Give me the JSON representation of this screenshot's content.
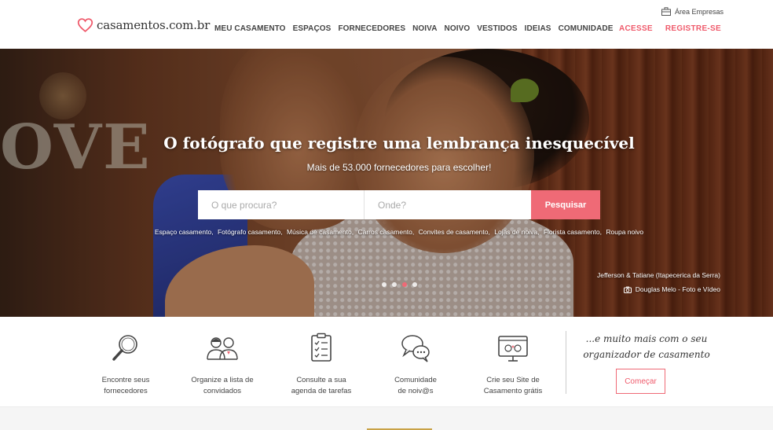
{
  "header": {
    "logo_text": "casamentos.com.br",
    "nav": [
      "Meu casamento",
      "Espaços",
      "Fornecedores",
      "Noiva",
      "Noivo",
      "Vestidos",
      "Ideias",
      "Comunidade"
    ],
    "area_empresas": "Área Empresas",
    "login": "ACESSE",
    "register": "REGISTRE-SE"
  },
  "hero": {
    "title": "O fotógrafo que registre uma lembrança inesquecível",
    "subtitle": "Mais de 53.000 fornecedores para escolher!",
    "background_text": "OVE",
    "search": {
      "what_placeholder": "O que procura?",
      "where_placeholder": "Onde?",
      "button": "Pesquisar"
    },
    "popular": [
      "Espaço casamento",
      "Fotógrafo casamento",
      "Música de casamento",
      "Carros casamento",
      "Convites de casamento",
      "Lojas de noiva",
      "Florista casamento",
      "Roupa noivo"
    ],
    "credit_couple": "Jefferson & Tatiane (Itapecerica da Serra)",
    "credit_photographer": "Douglas Melo - Foto e Vídeo",
    "slides": 4,
    "active_slide": 3
  },
  "features": {
    "items": [
      {
        "icon": "magnifier-icon",
        "line1": "Encontre seus",
        "line2": "fornecedores"
      },
      {
        "icon": "guests-icon",
        "line1": "Organize a lista de",
        "line2": "convidados"
      },
      {
        "icon": "checklist-icon",
        "line1": "Consulte a sua",
        "line2": "agenda de tarefas"
      },
      {
        "icon": "chat-bubbles-icon",
        "line1": "Comunidade",
        "line2": "de noiv@s"
      },
      {
        "icon": "website-icon",
        "line1": "Crie seu Site de",
        "line2": "Casamento grátis"
      }
    ],
    "tagline_line1": "...e muito mais com o seu",
    "tagline_line2": "organizador de casamento",
    "start_button": "Começar"
  },
  "colors": {
    "accent": "#ef6a76",
    "accent_text": "#ef5a6b",
    "gold": "#c9a247"
  }
}
